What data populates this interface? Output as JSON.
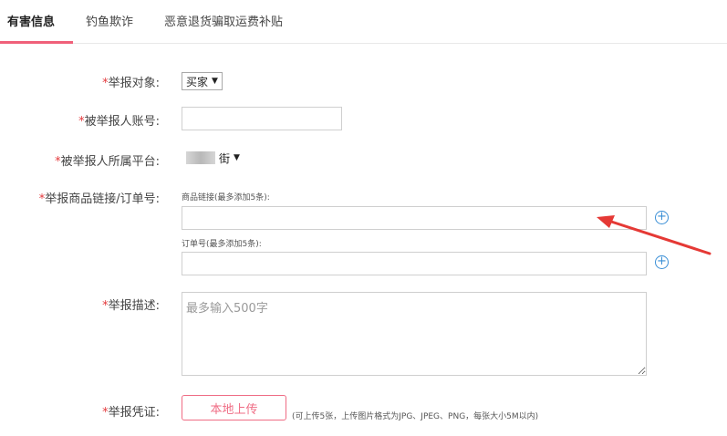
{
  "tabs": [
    {
      "label": "有害信息"
    },
    {
      "label": "钓鱼欺诈"
    },
    {
      "label": "恶意退货骗取运费补贴"
    }
  ],
  "form": {
    "required_mark": "*",
    "target": {
      "label": "举报对象:",
      "selected": "买家"
    },
    "account": {
      "label": "被举报人账号:",
      "value": ""
    },
    "platform": {
      "label": "被举报人所属平台:",
      "selected_suffix": "街"
    },
    "links": {
      "label": "举报商品链接/订单号:",
      "goods_hint": "商品链接(最多添加5条):",
      "order_hint": "订单号(最多添加5条):"
    },
    "description": {
      "label": "举报描述:",
      "placeholder": "最多输入500字"
    },
    "evidence": {
      "label": "举报凭证:",
      "upload_label": "本地上传",
      "note": "(可上传5张，上传图片格式为JPG、JPEG、PNG，每张大小5M以内)"
    }
  },
  "icons": {
    "add": "plus-circle-icon",
    "caret": "caret-down-icon",
    "arrow": "red-arrow-annotation"
  },
  "colors": {
    "accent": "#f0607a",
    "required": "#e4393c",
    "add_icon": "#3a8fd6",
    "arrow": "#e53935"
  }
}
